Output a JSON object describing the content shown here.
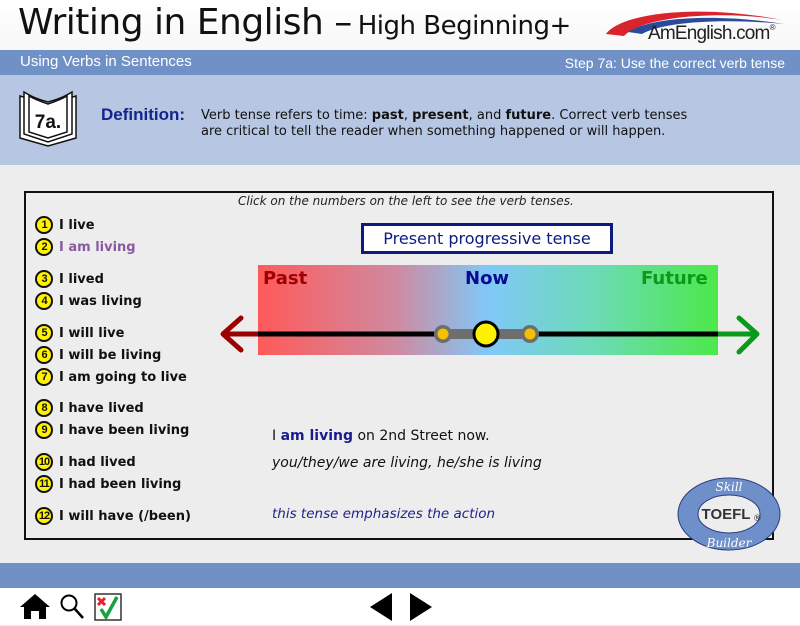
{
  "header": {
    "title": "Writing in English –",
    "subtitle": "High Beginning+",
    "logo_text": "AmEnglish.com",
    "logo_mark": "®"
  },
  "titlebar": {
    "section": "Using Verbs in Sentences",
    "step": "Step 7a: Use the correct verb tense"
  },
  "definition": {
    "badge": "7a.",
    "label": "Definition:",
    "line1_prefix": "Verb tense refers to time: ",
    "past": "past",
    "sep1": ", ",
    "present": "present",
    "sep2": ", and ",
    "future": "future",
    "line1_suffix": ".  Correct verb tenses",
    "line2": "are critical to tell the reader when something happened or will happen."
  },
  "main": {
    "instruction": "Click on the numbers on the left to see the verb tenses.",
    "items": [
      {
        "num": "1",
        "label": "I live"
      },
      {
        "num": "2",
        "label": "I am living",
        "active": true
      },
      {
        "num": "3",
        "label": "I lived"
      },
      {
        "num": "4",
        "label": "I was living"
      },
      {
        "num": "5",
        "label": "I will live"
      },
      {
        "num": "6",
        "label": "I will be living"
      },
      {
        "num": "7",
        "label": "I am going to live"
      },
      {
        "num": "8",
        "label": "I have lived"
      },
      {
        "num": "9",
        "label": "I have been living"
      },
      {
        "num": "10",
        "label": "I had lived"
      },
      {
        "num": "11",
        "label": "I had been living"
      },
      {
        "num": "12",
        "label": "I will have (/been)"
      }
    ],
    "tense_title": "Present progressive tense",
    "timeline": {
      "past_label": "Past",
      "now_label": "Now",
      "future_label": "Future",
      "colors": {
        "past": "#a00000",
        "now": "#0a0a90",
        "future": "#0a9a1a",
        "marker": "#fff200",
        "side_marker": "#f5c000"
      }
    },
    "example_prefix": "I ",
    "example_verb": "am living",
    "example_suffix": " on 2nd Street now.",
    "conjugation": "you/they/we are living, he/she is living",
    "note": "this tense emphasizes the action"
  },
  "badge": {
    "top": "Skill",
    "middle": "TOEFL",
    "mark": "®",
    "bottom": "Builder"
  },
  "toolbar": {
    "home": "home-icon",
    "search": "search-icon",
    "quiz": "checklist-icon",
    "prev": "previous-arrow-icon",
    "next": "next-arrow-icon"
  },
  "colors": {
    "title_band": "#7091c6",
    "definition_band": "#b7c7e3",
    "accent_navy": "#13248a",
    "active_item": "#8a5aa0"
  }
}
